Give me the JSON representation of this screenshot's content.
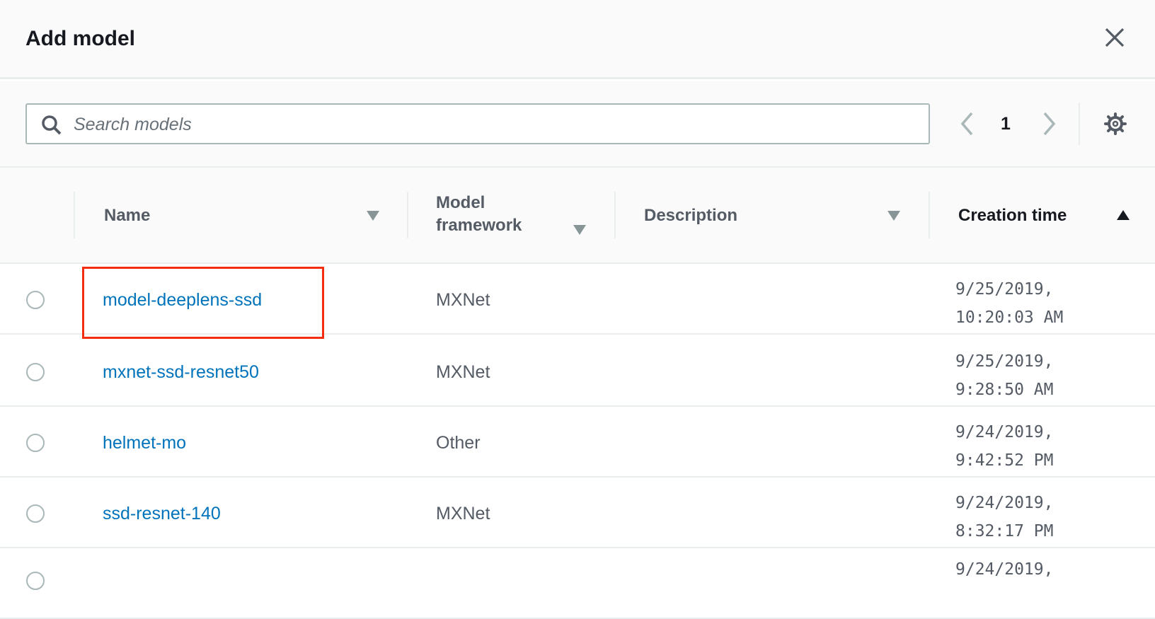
{
  "modal": {
    "title": "Add model"
  },
  "search": {
    "placeholder": "Search models"
  },
  "pagination": {
    "page": "1"
  },
  "table": {
    "columns": [
      "Name",
      "Model framework",
      "Description",
      "Creation time"
    ],
    "column_framework_lines": [
      "Model",
      "framework"
    ],
    "rows": [
      {
        "name": "model-deeplens-ssd",
        "framework": "MXNet",
        "description": "",
        "date": "9/25/2019,",
        "time": "10:20:03 AM",
        "highlighted": true
      },
      {
        "name": "mxnet-ssd-resnet50",
        "framework": "MXNet",
        "description": "",
        "date": "9/25/2019,",
        "time": "9:28:50 AM"
      },
      {
        "name": "helmet-mo",
        "framework": "Other",
        "description": "",
        "date": "9/24/2019,",
        "time": "9:42:52 PM"
      },
      {
        "name": "ssd-resnet-140",
        "framework": "MXNet",
        "description": "",
        "date": "9/24/2019,",
        "time": "8:32:17 PM"
      },
      {
        "name": "",
        "framework": "",
        "description": "",
        "date": "9/24/2019,",
        "time": ""
      }
    ]
  },
  "colors": {
    "link": "#0073bb",
    "highlight": "#f52d10"
  }
}
